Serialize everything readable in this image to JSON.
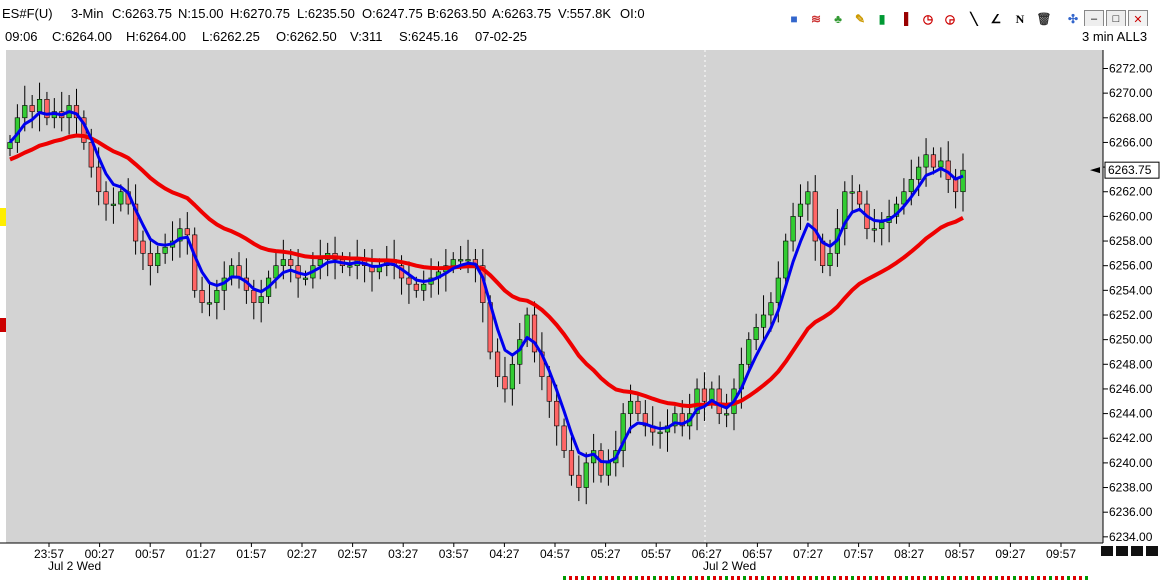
{
  "header": {
    "symbol": "ES#F(U)",
    "interval": "3-Min",
    "close": "C:6263.75",
    "net": "N:15.00",
    "high": "H:6270.75",
    "low": "L:6235.50",
    "open": "O:6247.75",
    "bid": "B:6263.50",
    "ask": "A:6263.75",
    "volume": "V:557.8K",
    "oi": "OI:0"
  },
  "bar_info": {
    "time": "09:06",
    "close": "C:6264.00",
    "high": "H:6264.00",
    "low": "L:6262.25",
    "open": "O:6262.50",
    "volume": "V:311",
    "settle": "S:6245.16",
    "date": "07-02-25"
  },
  "chart_label": "3 min ALL3",
  "window_buttons": {
    "minimize": "–",
    "restore": "□",
    "close": "✕"
  },
  "toolbar_icons": [
    "stack-icon",
    "rainbow-icon",
    "tree-icon",
    "pencil-icon",
    "bars-icon",
    "candle-icon",
    "clock-icon",
    "clock-icon-2",
    "line-tool-icon",
    "angle-tool-icon",
    "n-tool-icon",
    "trash-icon",
    "crosshair-icon"
  ],
  "colors": {
    "up_candle": "#33cc33",
    "down_candle": "#ff6666",
    "fast_ma": "#0000ee",
    "slow_ma": "#ee0000",
    "plot_bg": "#d3d3d3"
  },
  "chart_data": {
    "type": "candlestick",
    "x_tick_labels": [
      "23:57",
      "00:27",
      "00:57",
      "01:27",
      "01:57",
      "02:27",
      "02:57",
      "03:27",
      "03:57",
      "04:27",
      "04:57",
      "05:27",
      "05:57",
      "06:27",
      "06:57",
      "07:27",
      "07:57",
      "08:27",
      "08:57",
      "09:27",
      "09:57"
    ],
    "date_labels": [
      "Jul 2 Wed",
      "Jul 2 Wed"
    ],
    "y_tick_labels": [
      "6272.00",
      "6270.00",
      "6268.00",
      "6266.00",
      "6264.00",
      "6262.00",
      "6260.00",
      "6258.00",
      "6256.00",
      "6254.00",
      "6252.00",
      "6250.00",
      "6248.00",
      "6246.00",
      "6244.00",
      "6242.00",
      "6240.00",
      "6238.00",
      "6236.00",
      "6234.00"
    ],
    "ylim": [
      6233.5,
      6273.5
    ],
    "last_price_label": "6263.75",
    "last_price": 6263.75,
    "close_series": [
      6266,
      6268,
      6269,
      6268.5,
      6269.5,
      6268,
      6268.5,
      6268,
      6269,
      6268,
      6266,
      6264,
      6262,
      6261,
      6261,
      6262,
      6261,
      6258,
      6257,
      6256,
      6257,
      6257.5,
      6258,
      6259,
      6258.5,
      6254,
      6253,
      6253,
      6254,
      6255,
      6256,
      6255,
      6254,
      6253,
      6253.5,
      6255,
      6256,
      6256.5,
      6256,
      6255,
      6255,
      6256,
      6256.5,
      6257,
      6256.5,
      6256,
      6256,
      6256.5,
      6256,
      6255.5,
      6256,
      6256.5,
      6256,
      6255,
      6254.5,
      6254,
      6254.5,
      6255,
      6255.5,
      6256,
      6256.5,
      6256.5,
      6256.5,
      6256,
      6253,
      6249,
      6247,
      6246,
      6248,
      6250,
      6252,
      6249,
      6247,
      6245,
      6243,
      6241,
      6239,
      6238,
      6240,
      6241,
      6239,
      6240,
      6241,
      6244,
      6245,
      6244,
      6243,
      6242.5,
      6242.5,
      6243,
      6244,
      6243,
      6244,
      6246,
      6245,
      6246,
      6244,
      6244,
      6246,
      6248,
      6250,
      6251,
      6252,
      6253,
      6255,
      6258,
      6260,
      6261,
      6262,
      6258,
      6256,
      6257,
      6259,
      6262,
      6262,
      6261,
      6259,
      6259,
      6259.5,
      6260,
      6261,
      6262,
      6263,
      6264,
      6265,
      6264,
      6264.5,
      6263,
      6262,
      6263.75
    ]
  }
}
